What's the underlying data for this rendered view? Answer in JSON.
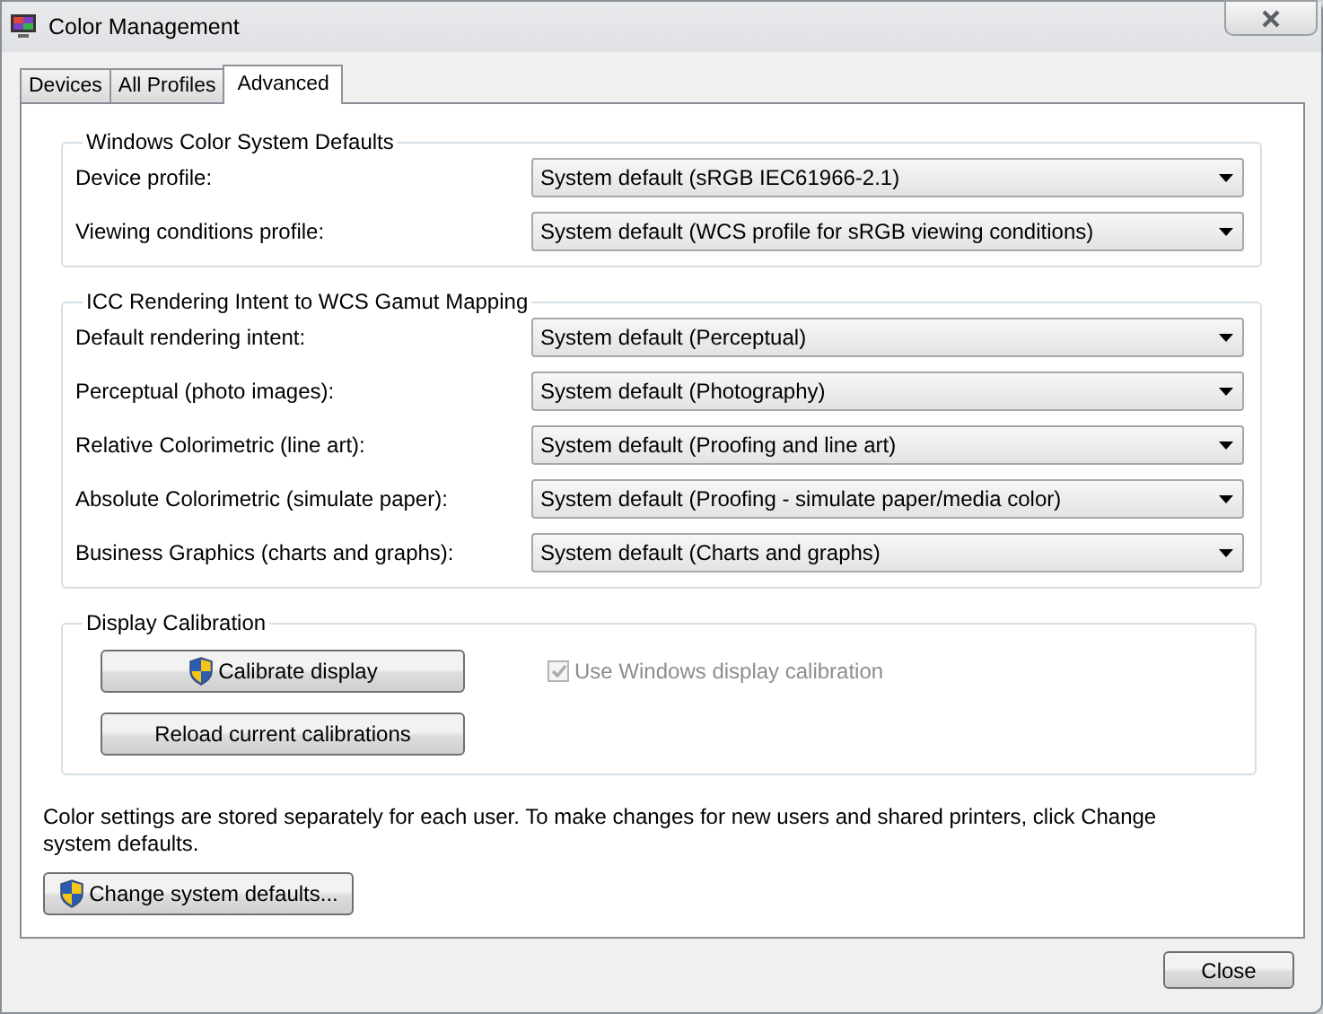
{
  "window": {
    "title": "Color Management"
  },
  "tabs": [
    {
      "label": "Devices",
      "selected": false
    },
    {
      "label": "All Profiles",
      "selected": false
    },
    {
      "label": "Advanced",
      "selected": true
    }
  ],
  "groups": [
    {
      "kind": "dropdowns",
      "title": "Windows Color System Defaults",
      "rows": [
        {
          "label": "Device profile:",
          "value": "System default (sRGB IEC61966-2.1)"
        },
        {
          "label": "Viewing conditions profile:",
          "value": "System default (WCS profile for sRGB viewing conditions)"
        }
      ]
    },
    {
      "kind": "dropdowns",
      "title": "ICC Rendering Intent to WCS Gamut Mapping",
      "rows": [
        {
          "label": "Default rendering intent:",
          "value": "System default (Perceptual)"
        },
        {
          "label": "Perceptual (photo images):",
          "value": "System default (Photography)"
        },
        {
          "label": "Relative Colorimetric (line art):",
          "value": "System default (Proofing and line art)"
        },
        {
          "label": "Absolute Colorimetric (simulate paper):",
          "value": "System default (Proofing - simulate paper/media color)"
        },
        {
          "label": "Business Graphics (charts and graphs):",
          "value": "System default (Charts and graphs)"
        }
      ]
    },
    {
      "kind": "calibration",
      "title": "Display Calibration",
      "buttons": [
        {
          "label": "Calibrate display",
          "shield": true
        },
        {
          "label": "Reload current calibrations",
          "shield": false
        }
      ],
      "checkbox": {
        "label": "Use Windows display calibration",
        "checked": true,
        "disabled": true
      }
    }
  ],
  "note": "Color settings are stored separately for each user. To make changes for new users and shared printers, click Change system defaults.",
  "change_button": {
    "label": "Change system defaults...",
    "shield": true
  },
  "close_button": {
    "label": "Close"
  }
}
